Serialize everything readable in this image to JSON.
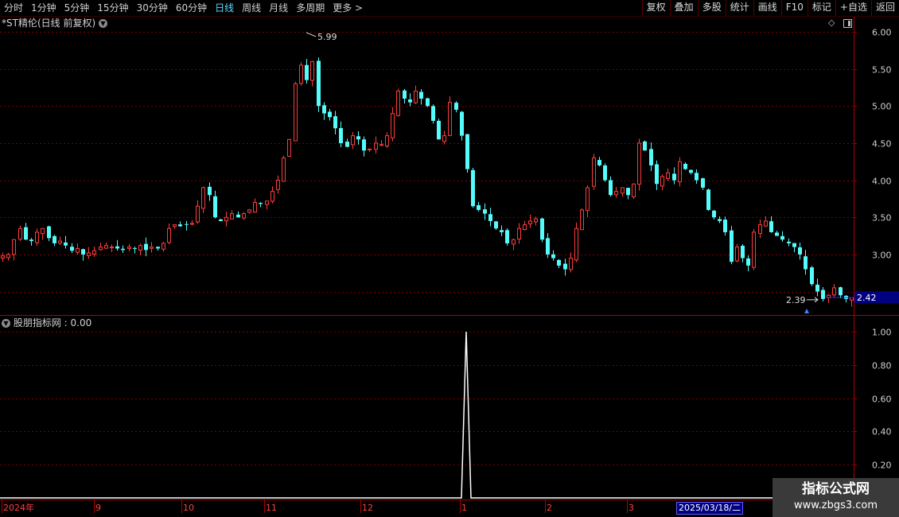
{
  "toolbar": {
    "periods": [
      "分时",
      "1分钟",
      "5分钟",
      "15分钟",
      "30分钟",
      "60分钟",
      "日线",
      "周线",
      "月线",
      "多周期",
      "更多 >"
    ],
    "active_period": "日线",
    "buttons": [
      "复权",
      "叠加",
      "多股",
      "统计",
      "画线",
      "F10",
      "标记",
      "+自选",
      "返回"
    ]
  },
  "price_panel": {
    "title": "*ST精伦(日线 前复权)",
    "y_axis_labels": [
      "6.00",
      "5.50",
      "5.00",
      "4.50",
      "4.00",
      "3.50",
      "3.00"
    ],
    "current_price_label": "2.42",
    "high_annotation": "5.99",
    "low_annotation": "2.39"
  },
  "indicator_panel": {
    "title": "股朋指标网 : 0.00",
    "y_axis_labels": [
      "1.00",
      "0.80",
      "0.60",
      "0.40",
      "0.20"
    ]
  },
  "time_axis": {
    "labels": [
      "2024年",
      "9",
      "10",
      "11",
      "12",
      "1",
      "2",
      "3"
    ],
    "cursor_date": "2025/03/18/二"
  },
  "watermark": {
    "title": "指标公式网",
    "url": "www.zbgs3.com"
  },
  "colors": {
    "up": "#ff3c3c",
    "down": "#54fcfc",
    "grid": "#7a0000",
    "axis": "#b00000",
    "price_tag_bg": "#000080",
    "indicator_line": "#ffffff"
  },
  "chart_data": [
    {
      "type": "candlestick",
      "title": "*ST精伦(日线 前复权)",
      "ylim": [
        2.39,
        6.0
      ],
      "high": 5.99,
      "low": 2.39,
      "last": 2.42,
      "close_series": [
        2.98,
        3.0,
        3.2,
        3.35,
        3.2,
        3.18,
        3.3,
        3.35,
        3.22,
        3.15,
        3.18,
        3.12,
        3.05,
        3.08,
        3.0,
        3.02,
        3.05,
        3.1,
        3.12,
        3.1,
        3.08,
        3.06,
        3.1,
        3.08,
        3.12,
        3.06,
        3.1,
        3.08,
        3.15,
        3.35,
        3.4,
        3.38,
        3.4,
        3.42,
        3.65,
        3.9,
        3.8,
        3.5,
        3.45,
        3.5,
        3.55,
        3.5,
        3.55,
        3.6,
        3.7,
        3.68,
        3.72,
        3.85,
        4.0,
        4.3,
        4.55,
        5.3,
        5.55,
        5.35,
        5.6,
        5.0,
        4.9,
        4.85,
        4.7,
        4.5,
        4.45,
        4.6,
        4.55,
        4.4,
        4.42,
        4.5,
        4.48,
        4.6,
        4.9,
        5.2,
        5.1,
        5.05,
        5.2,
        5.1,
        5.0,
        4.8,
        4.55,
        4.6,
        5.05,
        4.95,
        4.6,
        4.15,
        3.65,
        3.6,
        3.55,
        3.45,
        3.35,
        3.3,
        3.15,
        3.2,
        3.35,
        3.4,
        3.45,
        3.48,
        3.2,
        3.0,
        2.95,
        2.85,
        2.8,
        2.95,
        3.35,
        3.6,
        3.9,
        4.3,
        4.2,
        4.0,
        3.8,
        3.85,
        3.9,
        3.8,
        3.95,
        4.5,
        4.4,
        4.2,
        3.95,
        4.05,
        4.1,
        4.0,
        4.25,
        4.15,
        4.1,
        4.0,
        3.9,
        3.6,
        3.5,
        3.45,
        3.3,
        2.9,
        3.1,
        2.95,
        2.85,
        3.3,
        3.4,
        3.45,
        3.3,
        3.25,
        3.2,
        3.15,
        3.1,
        3.0,
        2.8,
        2.6,
        2.5,
        2.4,
        2.45,
        2.55,
        2.45,
        2.4,
        2.42
      ]
    },
    {
      "type": "line",
      "title": "股朋指标网",
      "ylim": [
        0,
        1.0
      ],
      "current_value": 0.0,
      "peak_value": 1.0
    }
  ]
}
